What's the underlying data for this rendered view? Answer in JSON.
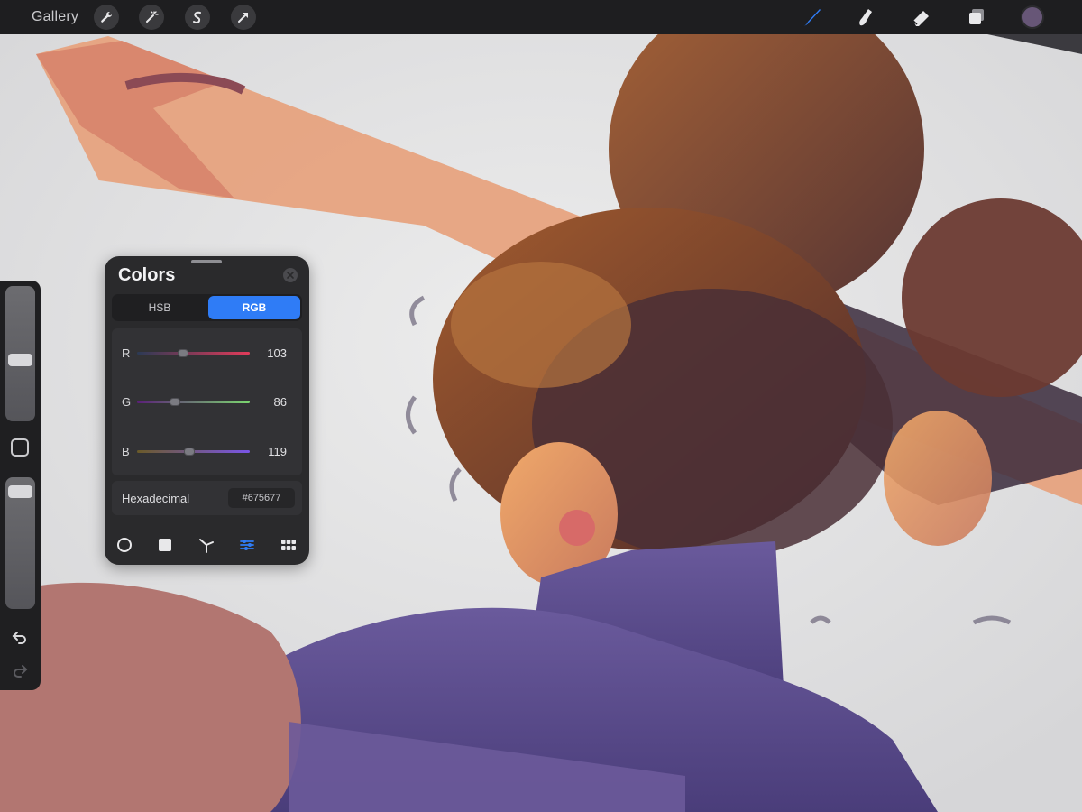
{
  "topbar": {
    "gallery_label": "Gallery",
    "actions": [
      "wrench-icon",
      "magic-wand-icon",
      "selection-icon",
      "transform-arrow-icon"
    ],
    "tools": [
      "brush-icon",
      "smudge-icon",
      "eraser-icon",
      "layers-icon"
    ],
    "current_color": "#675677",
    "active_tool_color": "#2f7cf6"
  },
  "sidebar": {
    "brush_size_level": 0.45,
    "opacity_level": 0.95,
    "modifier": "modify-button",
    "undo": "undo-icon",
    "redo": "redo-icon"
  },
  "colors_panel": {
    "title": "Colors",
    "tabs": [
      {
        "label": "HSB",
        "active": false
      },
      {
        "label": "RGB",
        "active": true
      }
    ],
    "channels": [
      {
        "label": "R",
        "value": "103",
        "fraction": 0.404
      },
      {
        "label": "G",
        "value": "86",
        "fraction": 0.337
      },
      {
        "label": "B",
        "value": "119",
        "fraction": 0.467
      }
    ],
    "hex_label": "Hexadecimal",
    "hex_value": "#675677",
    "modes": [
      "disc-icon",
      "classic-square-icon",
      "harmony-icon",
      "value-sliders-icon",
      "palettes-icon"
    ],
    "active_mode": "value-sliders-icon"
  }
}
